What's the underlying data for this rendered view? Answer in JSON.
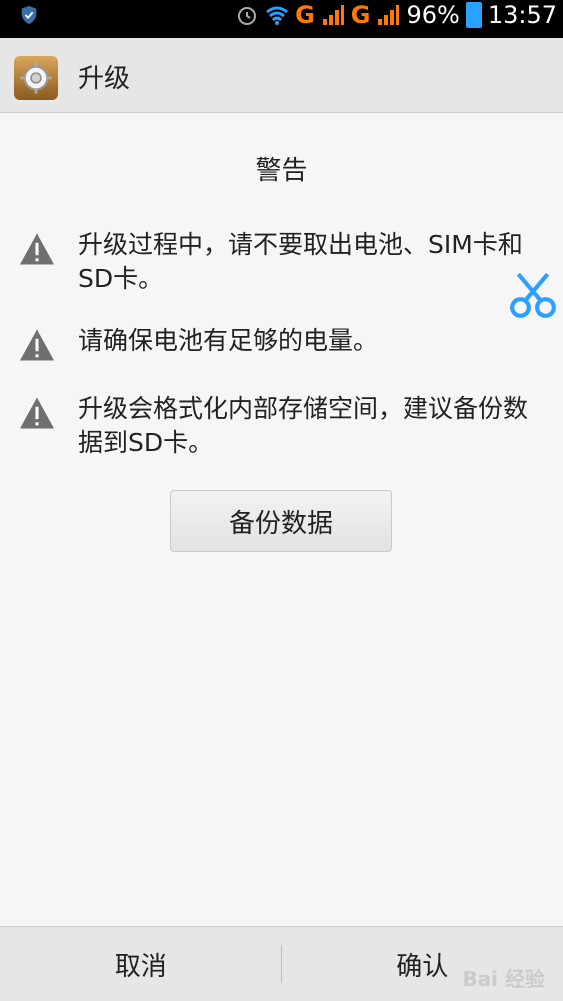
{
  "status_bar": {
    "network_1": "G",
    "network_2": "G",
    "battery": "96%",
    "time": "13:57",
    "icons": [
      "shield-icon",
      "alarm-icon",
      "wifi-icon",
      "signal-icon",
      "signal-icon",
      "battery-icon"
    ]
  },
  "app_bar": {
    "title": "升级",
    "icon": "gear-icon"
  },
  "dialog": {
    "title": "警告",
    "warnings": [
      {
        "text": "升级过程中，请不要取出电池、SIM卡和SD卡。"
      },
      {
        "text": "请确保电池有足够的电量。"
      },
      {
        "text": "升级会格式化内部存储空间，建议备份数据到SD卡。"
      }
    ],
    "backup_button": "备份数据"
  },
  "bottom_bar": {
    "cancel": "取消",
    "confirm": "确认"
  },
  "watermark": {
    "text": "Bai 经验"
  },
  "colors": {
    "accent_blue": "#2aa0ff",
    "network_orange": "#ff7a00",
    "background": "#f6f6f6"
  }
}
